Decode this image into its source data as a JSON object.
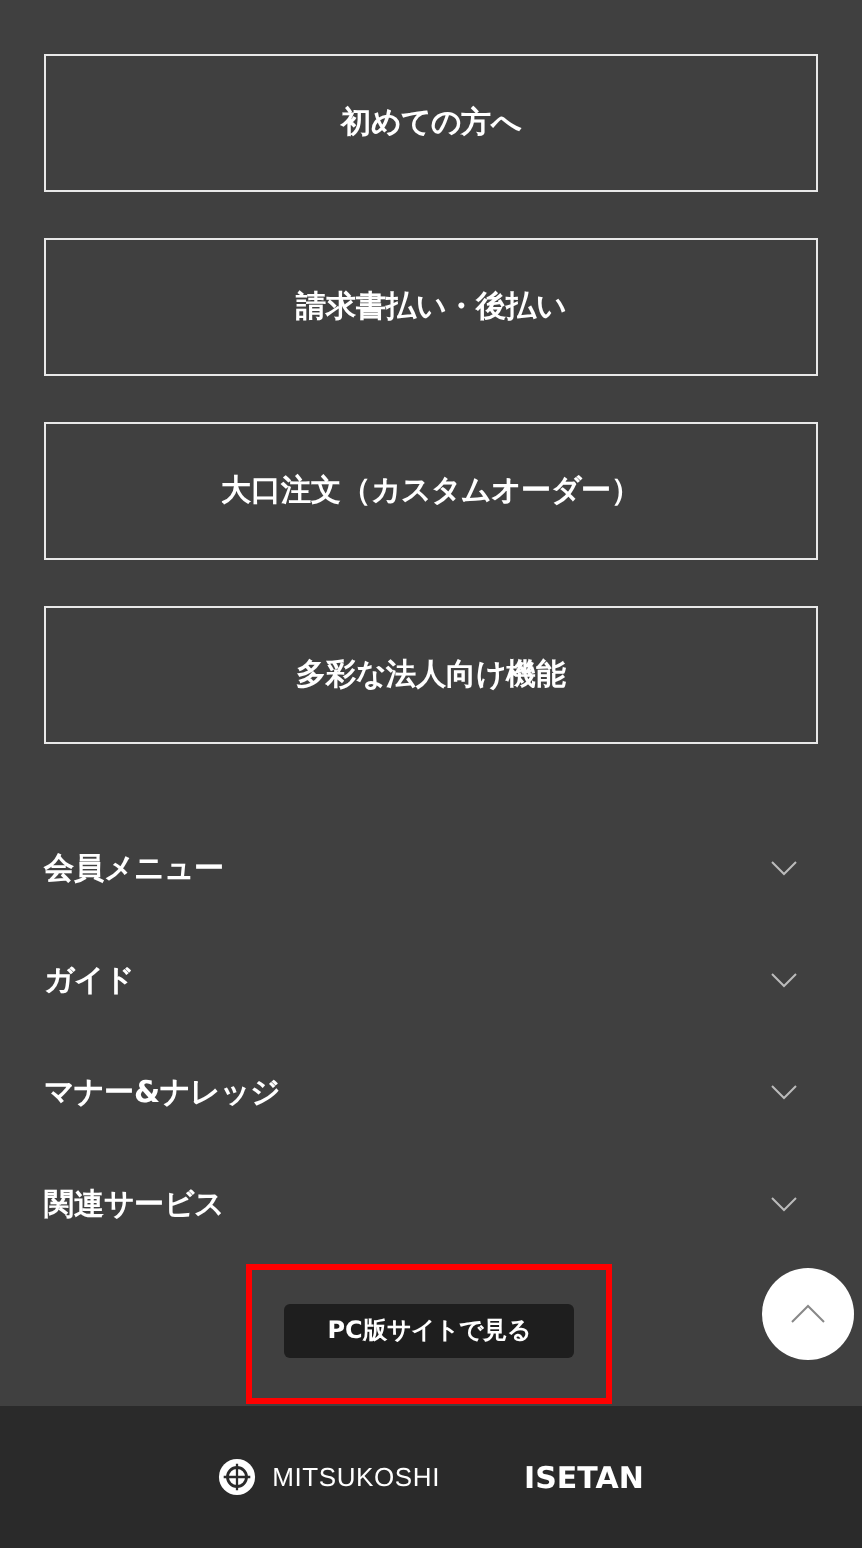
{
  "link_buttons": [
    {
      "label": "初めての方へ"
    },
    {
      "label": "請求書払い・後払い"
    },
    {
      "label": "大口注文（カスタムオーダー）"
    },
    {
      "label": "多彩な法人向け機能"
    }
  ],
  "accordion": [
    {
      "label": "会員メニュー",
      "expanded": false
    },
    {
      "label": "ガイド",
      "expanded": false
    },
    {
      "label": "マナー&ナレッジ",
      "expanded": false
    },
    {
      "label": "関連サービス",
      "expanded": false
    }
  ],
  "pc_site_button": {
    "label": "PC版サイトで見る",
    "highlighted": true
  },
  "footer": {
    "logos": [
      {
        "kind": "mitsukoshi",
        "text": "MITSUKOSHI"
      },
      {
        "kind": "isetan",
        "text": "ISETAN"
      }
    ]
  }
}
